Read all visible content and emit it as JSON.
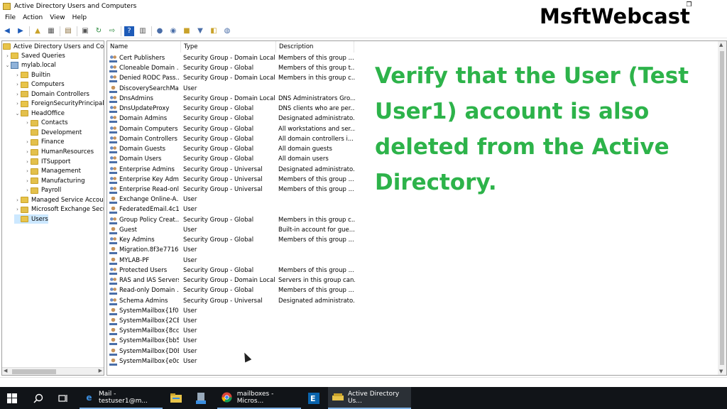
{
  "window": {
    "title": "Active Directory Users and Computers",
    "restore_glyph": "❐"
  },
  "menu": [
    "File",
    "Action",
    "View",
    "Help"
  ],
  "logo": "MsftWebcast",
  "overlay_text": "Verify that the User (Test User1) account is also deleted from the Active Directory.",
  "tree": {
    "root": "Active Directory Users and Com",
    "items": [
      {
        "label": "Saved Queries",
        "level": 1,
        "expander": "›",
        "icon": "folder"
      },
      {
        "label": "mylab.local",
        "level": 1,
        "expander": "⌄",
        "icon": "domain"
      },
      {
        "label": "Builtin",
        "level": 2,
        "expander": "›",
        "icon": "folder"
      },
      {
        "label": "Computers",
        "level": 2,
        "expander": "›",
        "icon": "folder"
      },
      {
        "label": "Domain Controllers",
        "level": 2,
        "expander": "›",
        "icon": "ou"
      },
      {
        "label": "ForeignSecurityPrincipals",
        "level": 2,
        "expander": "›",
        "icon": "folder"
      },
      {
        "label": "HeadOffice",
        "level": 2,
        "expander": "⌄",
        "icon": "ou"
      },
      {
        "label": "Contacts",
        "level": 3,
        "expander": "›",
        "icon": "ou"
      },
      {
        "label": "Development",
        "level": 3,
        "expander": "",
        "icon": "ou"
      },
      {
        "label": "Finance",
        "level": 3,
        "expander": "›",
        "icon": "ou"
      },
      {
        "label": "HumanResources",
        "level": 3,
        "expander": "›",
        "icon": "ou"
      },
      {
        "label": "ITSupport",
        "level": 3,
        "expander": "›",
        "icon": "ou"
      },
      {
        "label": "Management",
        "level": 3,
        "expander": "›",
        "icon": "ou"
      },
      {
        "label": "Manufacturing",
        "level": 3,
        "expander": "›",
        "icon": "ou"
      },
      {
        "label": "Payroll",
        "level": 3,
        "expander": "›",
        "icon": "ou"
      },
      {
        "label": "Managed Service Accour",
        "level": 2,
        "expander": "›",
        "icon": "folder"
      },
      {
        "label": "Microsoft Exchange Secu",
        "level": 2,
        "expander": "›",
        "icon": "ou"
      },
      {
        "label": "Users",
        "level": 2,
        "expander": "",
        "icon": "folder",
        "selected": true
      }
    ]
  },
  "columns": [
    "Name",
    "Type",
    "Description"
  ],
  "rows": [
    {
      "name": "Cert Publishers",
      "type": "Security Group - Domain Local",
      "desc": "Members of this group ...",
      "icon": "group"
    },
    {
      "name": "Cloneable Domain ...",
      "type": "Security Group - Global",
      "desc": "Members of this group t...",
      "icon": "group"
    },
    {
      "name": "Denied RODC Pass...",
      "type": "Security Group - Domain Local",
      "desc": "Members in this group c...",
      "icon": "group"
    },
    {
      "name": "DiscoverySearchMa...",
      "type": "User",
      "desc": "",
      "icon": "user"
    },
    {
      "name": "DnsAdmins",
      "type": "Security Group - Domain Local",
      "desc": "DNS Administrators Gro...",
      "icon": "group"
    },
    {
      "name": "DnsUpdateProxy",
      "type": "Security Group - Global",
      "desc": "DNS clients who are per...",
      "icon": "group"
    },
    {
      "name": "Domain Admins",
      "type": "Security Group - Global",
      "desc": "Designated administrato...",
      "icon": "group"
    },
    {
      "name": "Domain Computers",
      "type": "Security Group - Global",
      "desc": "All workstations and ser...",
      "icon": "group"
    },
    {
      "name": "Domain Controllers",
      "type": "Security Group - Global",
      "desc": "All domain controllers i...",
      "icon": "group"
    },
    {
      "name": "Domain Guests",
      "type": "Security Group - Global",
      "desc": "All domain guests",
      "icon": "group"
    },
    {
      "name": "Domain Users",
      "type": "Security Group - Global",
      "desc": "All domain users",
      "icon": "group"
    },
    {
      "name": "Enterprise Admins",
      "type": "Security Group - Universal",
      "desc": "Designated administrato...",
      "icon": "group"
    },
    {
      "name": "Enterprise Key Adm...",
      "type": "Security Group - Universal",
      "desc": "Members of this group ...",
      "icon": "group"
    },
    {
      "name": "Enterprise Read-onl...",
      "type": "Security Group - Universal",
      "desc": "Members of this group ...",
      "icon": "group"
    },
    {
      "name": "Exchange Online-A...",
      "type": "User",
      "desc": "",
      "icon": "user"
    },
    {
      "name": "FederatedEmail.4c1...",
      "type": "User",
      "desc": "",
      "icon": "user"
    },
    {
      "name": "Group Policy Creat...",
      "type": "Security Group - Global",
      "desc": "Members in this group c...",
      "icon": "group"
    },
    {
      "name": "Guest",
      "type": "User",
      "desc": "Built-in account for gue...",
      "icon": "user"
    },
    {
      "name": "Key Admins",
      "type": "Security Group - Global",
      "desc": "Members of this group ...",
      "icon": "group"
    },
    {
      "name": "Migration.8f3e7716...",
      "type": "User",
      "desc": "",
      "icon": "user"
    },
    {
      "name": "MYLAB-PF",
      "type": "User",
      "desc": "",
      "icon": "user"
    },
    {
      "name": "Protected Users",
      "type": "Security Group - Global",
      "desc": "Members of this group ...",
      "icon": "group"
    },
    {
      "name": "RAS and IAS Servers",
      "type": "Security Group - Domain Local",
      "desc": "Servers in this group can...",
      "icon": "group"
    },
    {
      "name": "Read-only Domain ...",
      "type": "Security Group - Global",
      "desc": "Members of this group ...",
      "icon": "group"
    },
    {
      "name": "Schema Admins",
      "type": "Security Group - Universal",
      "desc": "Designated administrato...",
      "icon": "group"
    },
    {
      "name": "SystemMailbox{1f0...",
      "type": "User",
      "desc": "",
      "icon": "user"
    },
    {
      "name": "SystemMailbox{2CE...",
      "type": "User",
      "desc": "",
      "icon": "user"
    },
    {
      "name": "SystemMailbox{8cc...",
      "type": "User",
      "desc": "",
      "icon": "user"
    },
    {
      "name": "SystemMailbox{bb5...",
      "type": "User",
      "desc": "",
      "icon": "user"
    },
    {
      "name": "SystemMailbox{D0E...",
      "type": "User",
      "desc": "",
      "icon": "user"
    },
    {
      "name": "SystemMailbox{e0d...",
      "type": "User",
      "desc": "",
      "icon": "user"
    }
  ],
  "taskbar": {
    "items": [
      {
        "label": "Mail - testuser1@m...",
        "icon": "edge-icon"
      },
      {
        "label": "mailboxes - Micros...",
        "icon": "chrome-icon"
      },
      {
        "label": "Active Directory Us...",
        "icon": "ad-icon"
      }
    ]
  }
}
